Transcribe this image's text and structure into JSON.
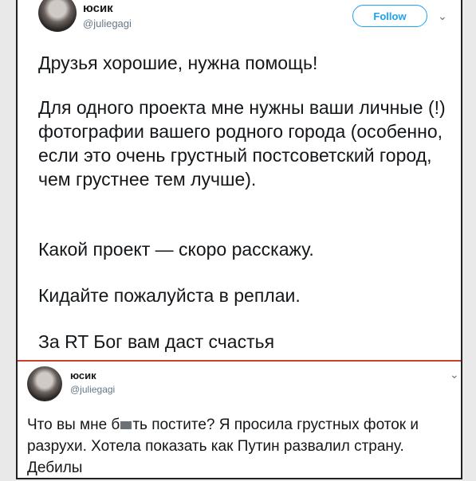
{
  "tweet": {
    "display_name": "юсик",
    "handle": "@juliegagi",
    "follow_label": "Follow",
    "paragraphs": [
      "Друзья хорошие, нужна помощь!",
      "Для одного проекта мне нужны ваши личные (!) фотографии вашего родного города (особенно, если это очень грустный постсоветский город, чем грустнее тем лучше).",
      "Какой проект — скоро расскажу.",
      "Кидайте пожалуйста в реплаи.",
      "За RT Бог вам даст счастья"
    ]
  },
  "reply": {
    "display_name": "юсик",
    "handle": "@juliegagi",
    "text_before": "Что вы мне б",
    "text_after": "ть постите? Я просила грустных фоток и разрухи. Хотела показать как Путин развалил страну. Дебилы"
  },
  "icons": {
    "menu": "chevron-down-icon"
  }
}
